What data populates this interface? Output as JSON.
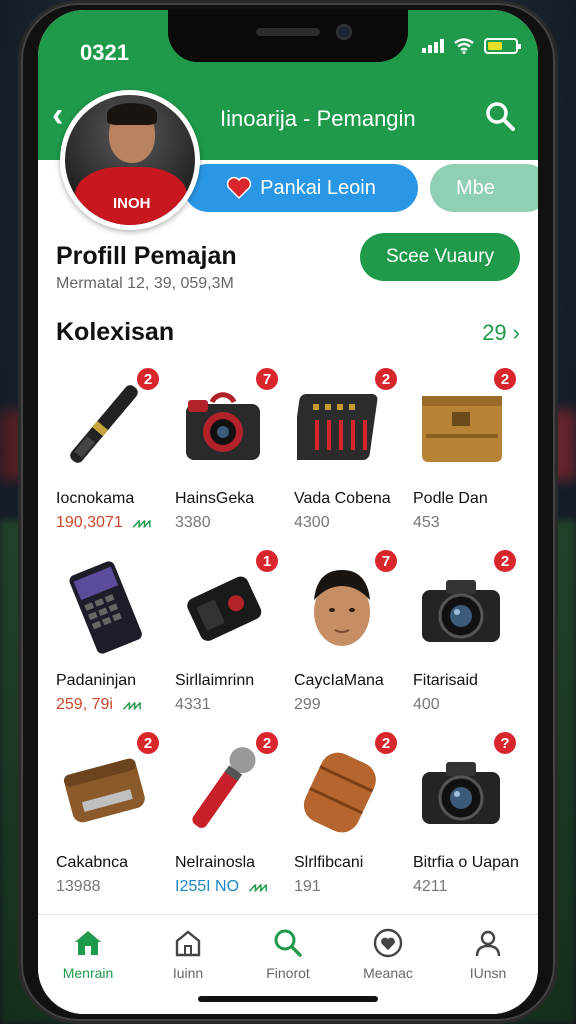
{
  "status": {
    "time": "0321"
  },
  "header": {
    "title": "Iinoarija - Pemangin"
  },
  "player": {
    "jersey_text": "INOH"
  },
  "tabs": {
    "primary": "Pankai Leoin",
    "secondary": "Mbe"
  },
  "profile": {
    "title": "Profill Pemajan",
    "subtitle": "Mermatal 12, 39, 059,3M",
    "see_button": "Scee Vuaury"
  },
  "collection": {
    "title": "Kolexisan",
    "count": "29",
    "items": [
      {
        "name": "Iocnokama",
        "value": "190,3071",
        "value_style": "red",
        "trend": true,
        "badge": "2",
        "icon": "monopod-icon"
      },
      {
        "name": "HainsGeka",
        "value": "3380",
        "value_style": "grey",
        "trend": false,
        "badge": "7",
        "icon": "camera-icon"
      },
      {
        "name": "Vada Cobena",
        "value": "4300",
        "value_style": "grey",
        "trend": false,
        "badge": "2",
        "icon": "audio-mixer-icon"
      },
      {
        "name": "Podle Dan",
        "value": "453",
        "value_style": "grey",
        "trend": false,
        "badge": "2",
        "icon": "wooden-case-icon"
      },
      {
        "name": "Padaninjan",
        "value": "259, 79i",
        "value_style": "red",
        "trend": true,
        "badge": "",
        "icon": "phone-keyboard-icon"
      },
      {
        "name": "Sirllaimrinn",
        "value": "4331",
        "value_style": "grey",
        "trend": false,
        "badge": "1",
        "icon": "action-camera-icon"
      },
      {
        "name": "CaycIaMana",
        "value": "299",
        "value_style": "grey",
        "trend": false,
        "badge": "7",
        "icon": "player-face-icon"
      },
      {
        "name": "Fitarisaid",
        "value": "400",
        "value_style": "grey",
        "trend": false,
        "badge": "2",
        "icon": "dslr-camera-icon"
      },
      {
        "name": "Cakabnca",
        "value": "13988",
        "value_style": "grey",
        "trend": false,
        "badge": "2",
        "icon": "leather-case-icon"
      },
      {
        "name": "Nelrainosla",
        "value": "I255I NO",
        "value_style": "blue",
        "trend": true,
        "badge": "2",
        "icon": "microphone-icon"
      },
      {
        "name": "Slrlfibcani",
        "value": "191",
        "value_style": "grey",
        "trend": false,
        "badge": "2",
        "icon": "leather-bag-icon"
      },
      {
        "name": "Bitrfia o Uapan",
        "value": "4211",
        "value_style": "grey",
        "trend": false,
        "badge": "?",
        "icon": "dslr-camera-icon"
      }
    ]
  },
  "nav": [
    {
      "label": "Menrain",
      "icon": "home-icon",
      "active": true
    },
    {
      "label": "Iuinn",
      "icon": "house-outline-icon",
      "active": false
    },
    {
      "label": "Finorot",
      "icon": "search-icon",
      "active": false
    },
    {
      "label": "Meanac",
      "icon": "heart-circle-icon",
      "active": false
    },
    {
      "label": "IUnsn",
      "icon": "user-icon",
      "active": false
    }
  ],
  "colors": {
    "brand_green": "#1f9a4b",
    "badge_red": "#d9262d",
    "tab_blue": "#2a97e6",
    "tab_mint": "#8fcfb3"
  }
}
